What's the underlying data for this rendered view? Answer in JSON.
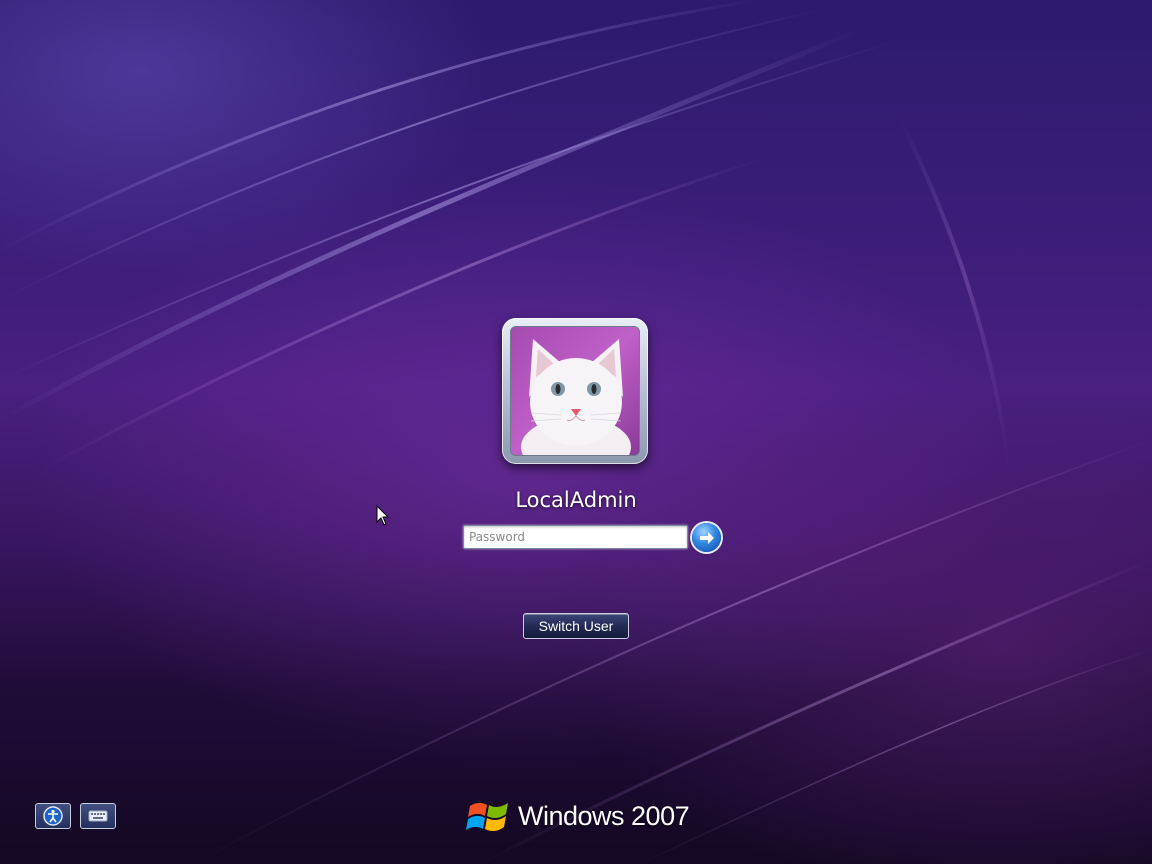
{
  "user": {
    "name": "LocalAdmin",
    "avatar_icon": "cat-avatar-icon"
  },
  "login": {
    "password_placeholder": "Password",
    "password_value": "",
    "submit_icon": "arrow-right-icon"
  },
  "actions": {
    "switch_user_label": "Switch User"
  },
  "footer": {
    "ease_of_access_icon": "ease-of-access-icon",
    "onscreen_keyboard_icon": "keyboard-icon",
    "brand_text": "Windows 2007",
    "brand_icon": "windows-flag-icon"
  },
  "colors": {
    "background": "#3a1d78",
    "accent_blue": "#2f86e0",
    "button_dark": "#232b55"
  }
}
